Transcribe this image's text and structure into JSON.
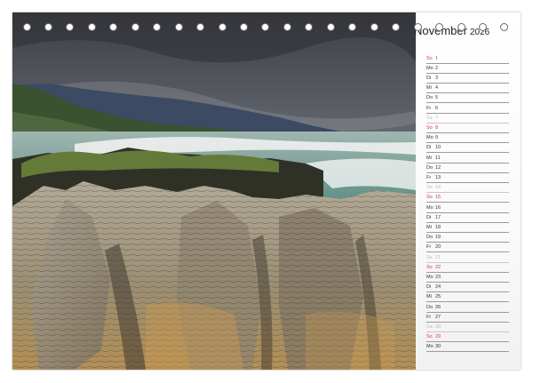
{
  "calendar": {
    "month": "November",
    "year": "2026",
    "days": [
      {
        "wd": "So",
        "num": "1",
        "type": "sun"
      },
      {
        "wd": "Mo",
        "num": "2",
        "type": "week"
      },
      {
        "wd": "Di",
        "num": "3",
        "type": "week"
      },
      {
        "wd": "Mi",
        "num": "4",
        "type": "week"
      },
      {
        "wd": "Do",
        "num": "5",
        "type": "week"
      },
      {
        "wd": "Fr",
        "num": "6",
        "type": "week"
      },
      {
        "wd": "Sa",
        "num": "7",
        "type": "sat"
      },
      {
        "wd": "So",
        "num": "8",
        "type": "sun"
      },
      {
        "wd": "Mo",
        "num": "9",
        "type": "week"
      },
      {
        "wd": "Di",
        "num": "10",
        "type": "week"
      },
      {
        "wd": "Mi",
        "num": "11",
        "type": "week"
      },
      {
        "wd": "Do",
        "num": "12",
        "type": "week"
      },
      {
        "wd": "Fr",
        "num": "13",
        "type": "week"
      },
      {
        "wd": "Sa",
        "num": "14",
        "type": "sat"
      },
      {
        "wd": "So",
        "num": "15",
        "type": "sun"
      },
      {
        "wd": "Mo",
        "num": "16",
        "type": "week"
      },
      {
        "wd": "Di",
        "num": "17",
        "type": "week"
      },
      {
        "wd": "Mi",
        "num": "18",
        "type": "week"
      },
      {
        "wd": "Do",
        "num": "19",
        "type": "week"
      },
      {
        "wd": "Fr",
        "num": "20",
        "type": "week"
      },
      {
        "wd": "Sa",
        "num": "21",
        "type": "sat"
      },
      {
        "wd": "So",
        "num": "22",
        "type": "sun"
      },
      {
        "wd": "Mo",
        "num": "23",
        "type": "week"
      },
      {
        "wd": "Di",
        "num": "24",
        "type": "week"
      },
      {
        "wd": "Mi",
        "num": "25",
        "type": "week"
      },
      {
        "wd": "Do",
        "num": "26",
        "type": "week"
      },
      {
        "wd": "Fr",
        "num": "27",
        "type": "week"
      },
      {
        "wd": "Sa",
        "num": "28",
        "type": "sat"
      },
      {
        "wd": "So",
        "num": "29",
        "type": "sun"
      },
      {
        "wd": "Mo",
        "num": "30",
        "type": "week"
      }
    ]
  },
  "photo": {
    "subject": "coastal-limestone-rock-landscape"
  },
  "binding": {
    "ring_count": 23
  },
  "colors": {
    "sunday": "#d23a3a",
    "saturday": "#bdbdbd",
    "weekday": "#333333",
    "rule": "#9a9a9a"
  }
}
